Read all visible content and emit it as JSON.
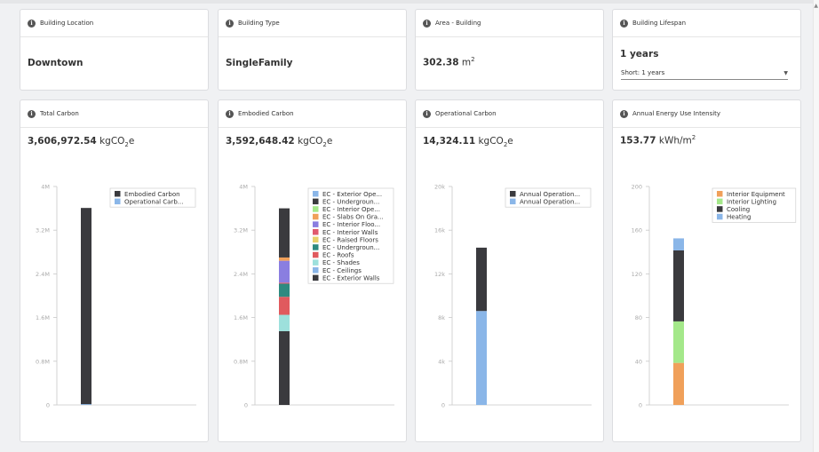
{
  "summary_cards": [
    {
      "title": "Building Location",
      "value": "Downtown"
    },
    {
      "title": "Building Type",
      "value": "SingleFamily"
    },
    {
      "title": "Area - Building",
      "value": "302.38",
      "unit": "m",
      "unit_sup": "2"
    },
    {
      "title": "Building Lifespan",
      "value": "1 years",
      "select_value": "Short: 1 years"
    }
  ],
  "chart_cards": [
    {
      "title": "Total Carbon",
      "value": "3,606,972.54",
      "unit": "kgCO",
      "unit_sub": "2",
      "unit_tail": "e"
    },
    {
      "title": "Embodied Carbon",
      "value": "3,592,648.42",
      "unit": "kgCO",
      "unit_sub": "2",
      "unit_tail": "e"
    },
    {
      "title": "Operational Carbon",
      "value": "14,324.11",
      "unit": "kgCO",
      "unit_sub": "2",
      "unit_tail": "e"
    },
    {
      "title": "Annual Energy Use Intensity",
      "value": "153.77",
      "unit": "kWh/m",
      "unit_sup": "2"
    }
  ],
  "icons": {
    "info": "info-icon",
    "dropdown": "chevron-down-icon"
  },
  "chart_data": [
    {
      "type": "bar",
      "stacked": true,
      "ylim": [
        0,
        4000000
      ],
      "yticks": [
        "0",
        "0.8M",
        "1.6M",
        "2.4M",
        "3.2M",
        "4M"
      ],
      "grid": false,
      "legend_position": "top-right",
      "series": [
        {
          "name": "Operational Carb...",
          "color": "#8ab6e8",
          "value": 14324
        },
        {
          "name": "Embodied Carbon",
          "color": "#3a3a3e",
          "value": 3592648
        }
      ]
    },
    {
      "type": "bar",
      "stacked": true,
      "ylim": [
        0,
        4000000
      ],
      "yticks": [
        "0",
        "0.8M",
        "1.6M",
        "2.4M",
        "3.2M",
        "4M"
      ],
      "grid": false,
      "legend_position": "top-right",
      "series": [
        {
          "name": "EC - Exterior Walls",
          "color": "#3a3a3e",
          "value": 1350000
        },
        {
          "name": "EC - Ceilings",
          "color": "#8ab6e8",
          "value": 0
        },
        {
          "name": "EC - Shades",
          "color": "#9de0dc",
          "value": 300000
        },
        {
          "name": "EC - Roofs",
          "color": "#e05a5e",
          "value": 330000
        },
        {
          "name": "EC - Undergroun...",
          "color": "#2e8a80",
          "value": 240000
        },
        {
          "name": "EC - Raised Floors",
          "color": "#e8d06a",
          "value": 0
        },
        {
          "name": "EC - Interior Walls",
          "color": "#e05a6e",
          "value": 20000
        },
        {
          "name": "EC - Interior Floo...",
          "color": "#8a7ee0",
          "value": 400000
        },
        {
          "name": "EC - Slabs On Gra...",
          "color": "#f0a05a",
          "value": 60000
        },
        {
          "name": "EC - Interior Ope...",
          "color": "#a4e88a",
          "value": 0
        },
        {
          "name": "EC - Undergroun...",
          "color": "#3a3a3e",
          "value": 900000
        },
        {
          "name": "EC - Exterior Ope...",
          "color": "#8ab6e8",
          "value": 0
        }
      ]
    },
    {
      "type": "bar",
      "stacked": true,
      "ylim": [
        0,
        20000
      ],
      "yticks": [
        "0",
        "4k",
        "8k",
        "12k",
        "16k",
        "20k"
      ],
      "grid": false,
      "legend_position": "top-right",
      "series": [
        {
          "name": "Annual Operation...",
          "color": "#8ab6e8",
          "value": 8600
        },
        {
          "name": "Annual Operation...",
          "color": "#3a3a3e",
          "value": 5800
        }
      ]
    },
    {
      "type": "bar",
      "stacked": true,
      "ylim": [
        0,
        200
      ],
      "yticks": [
        "0",
        "40",
        "80",
        "120",
        "160",
        "200"
      ],
      "grid": false,
      "legend_position": "top-right",
      "series": [
        {
          "name": "Heating",
          "color": "#8ab6e8",
          "value": 11
        },
        {
          "name": "Cooling",
          "color": "#3a3a3e",
          "value": 65
        },
        {
          "name": "Interior Lighting",
          "color": "#a4e88a",
          "value": 38
        },
        {
          "name": "Interior Equipment",
          "color": "#f0a05a",
          "value": 38.5
        }
      ],
      "stack_order": [
        3,
        2,
        1,
        0
      ]
    }
  ]
}
